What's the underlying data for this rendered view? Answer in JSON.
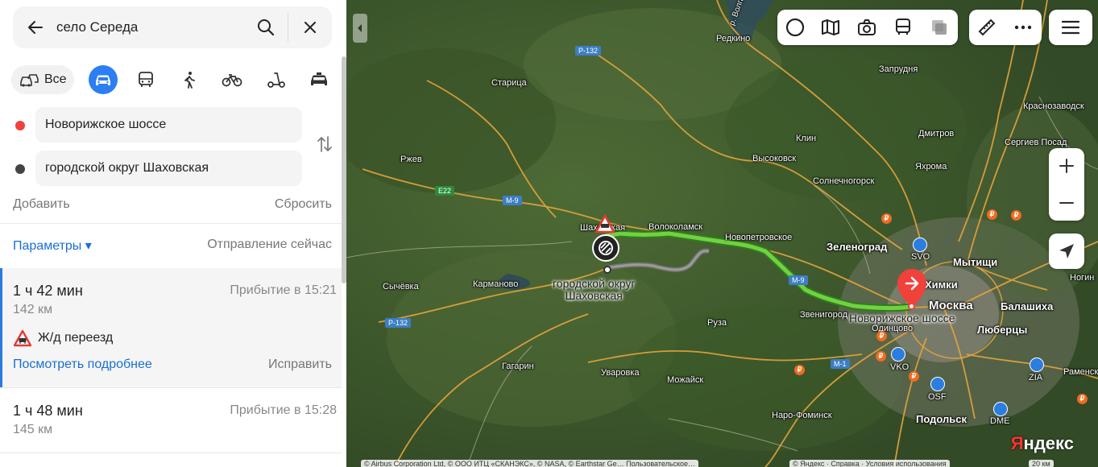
{
  "search": {
    "query": "село Середа"
  },
  "modes": {
    "all_label": "Все",
    "active": "car"
  },
  "waypoints": [
    {
      "label": "Новорижское шоссе",
      "color": "#f0413b"
    },
    {
      "label": "городской округ Шаховская",
      "color": "#444444"
    }
  ],
  "actions": {
    "add": "Добавить",
    "reset": "Сбросить"
  },
  "options": {
    "params": "Параметры ▾",
    "depart": "Отправление сейчас"
  },
  "routes": [
    {
      "time": "1 ч 42 мин",
      "distance": "142 км",
      "arrival": "Прибытие в 15:21",
      "warning": "Ж/д переезд",
      "details": "Посмотреть подробнее",
      "fix": "Исправить",
      "selected": true
    },
    {
      "time": "1 ч 48 мин",
      "distance": "145 км",
      "arrival": "Прибытие в 15:28"
    }
  ],
  "map": {
    "places": {
      "moskva": "Москва",
      "redkino": "Редкино",
      "volga": "р. Волга",
      "zaprudnya": "Запрудня",
      "staritsa": "Старица",
      "krasnozavodsk": "Красноза­водск",
      "dmitrov": "Дмитров",
      "sergiev": "Сергиев Посад",
      "klin": "Клин",
      "vysokovsk": "Высоковск",
      "yakhroma": "Яхрома",
      "rzhev": "Ржев",
      "solnechnogorsk": "Солнечногорск",
      "shakhovskaya": "Шаховская",
      "volokolamsk": "Волоколамск",
      "novopetrovskoe": "Новопетровское",
      "zelenograd": "Зеленоград",
      "mytishchi": "Мытищи",
      "khimki": "Химки",
      "nogin": "Ногин",
      "sychevka": "Сычёвка",
      "karmanovo": "Карманово",
      "ruza": "Руза",
      "zvenigorod": "Звенигород",
      "odintsovo": "Одинцово",
      "balashikha": "Балашиха",
      "lyubertsy": "Люберцы",
      "gagarin": "Гагарин",
      "uvarovka": "Уваровка",
      "mozhaysk": "Можайск",
      "naro_fominsk": "Наро-Фоминск",
      "podolsk": "Подольск",
      "ramensk": "Раменск",
      "svo": "SVO",
      "vko": "VKO",
      "osf": "OSF",
      "zia": "ZIA",
      "dme": "DME"
    },
    "roads": {
      "r132a": "Р-132",
      "r132b": "Р-132",
      "e22": "E22",
      "m9": "М-9",
      "m9b": "М-9",
      "m1": "М-1"
    },
    "destination_label": "городской округ\nШаховская",
    "origin_label": "Новорижское шоссе",
    "logo": "Яндекс",
    "copyright": "© Airbus Corporation Ltd, © ООО ИТЦ «СКАНЭКС», © NASA, © Earthstar Ge…   Пользовательское…",
    "copyright2": "© Яндекс · Справка · Условия использования",
    "scale": "20 км"
  }
}
